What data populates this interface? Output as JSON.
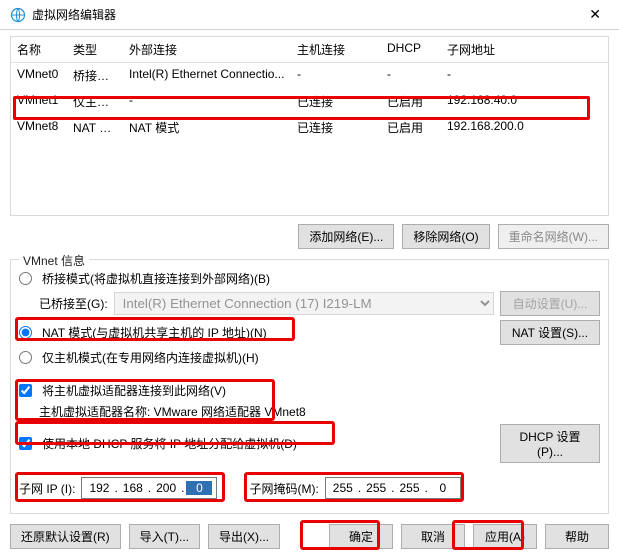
{
  "window": {
    "title": "虚拟网络编辑器"
  },
  "table": {
    "headers": {
      "name": "名称",
      "type": "类型",
      "ext": "外部连接",
      "host": "主机连接",
      "dhcp": "DHCP",
      "subnet": "子网地址"
    },
    "rows": [
      {
        "name": "VMnet0",
        "type": "桥接模式",
        "ext": "Intel(R) Ethernet Connectio...",
        "host": "-",
        "dhcp": "-",
        "subnet": "-"
      },
      {
        "name": "VMnet1",
        "type": "仅主机...",
        "ext": "-",
        "host": "已连接",
        "dhcp": "已启用",
        "subnet": "192.168.40.0"
      },
      {
        "name": "VMnet8",
        "type": "NAT 模式",
        "ext": "NAT 模式",
        "host": "已连接",
        "dhcp": "已启用",
        "subnet": "192.168.200.0"
      }
    ]
  },
  "buttons": {
    "add_net": "添加网络(E)...",
    "remove_net": "移除网络(O)",
    "rename_net": "重命名网络(W)...",
    "auto_set": "自动设置(U)...",
    "nat_set": "NAT 设置(S)...",
    "dhcp_set": "DHCP 设置(P)...",
    "restore": "还原默认设置(R)",
    "import": "导入(T)...",
    "export": "导出(X)...",
    "ok": "确定",
    "cancel": "取消",
    "apply": "应用(A)",
    "help": "帮助"
  },
  "info": {
    "section_title": "VMnet 信息",
    "bridge_label": "桥接模式(将虚拟机直接连接到外部网络)(B)",
    "bridge_to_label": "已桥接至(G):",
    "bridge_combo": "Intel(R) Ethernet Connection (17) I219-LM",
    "nat_label": "NAT 模式(与虚拟机共享主机的 IP 地址)(N)",
    "hostonly_label": "仅主机模式(在专用网络内连接虚拟机)(H)",
    "connect_host_label": "将主机虚拟适配器连接到此网络(V)",
    "adapter_name_label": "主机虚拟适配器名称: VMware 网络适配器 VMnet8",
    "dhcp_service_label": "使用本地 DHCP 服务将 IP 地址分配给虚拟机(D)",
    "subnet_ip_label": "子网 IP (I):",
    "subnet_mask_label": "子网掩码(M):",
    "subnet_ip": {
      "o1": "192",
      "o2": "168",
      "o3": "200",
      "o4": "0"
    },
    "subnet_mask": {
      "o1": "255",
      "o2": "255",
      "o3": "255",
      "o4": "0"
    }
  }
}
